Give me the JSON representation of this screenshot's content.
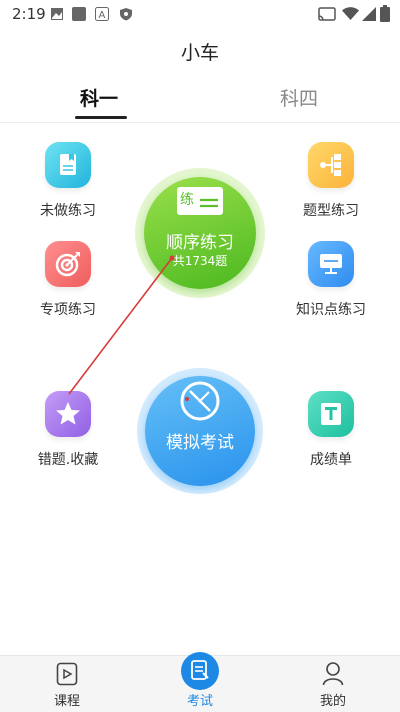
{
  "status": {
    "time": "2:19"
  },
  "header": {
    "title": "小车"
  },
  "tabs": [
    {
      "label": "科一"
    },
    {
      "label": "科四"
    }
  ],
  "features": {
    "undone": {
      "label": "未做练习"
    },
    "question_type": {
      "label": "题型练习"
    },
    "special": {
      "label": "专项练习"
    },
    "knowledge": {
      "label": "知识点练习"
    },
    "mistakes": {
      "label": "错题.收藏"
    },
    "score": {
      "label": "成绩单"
    }
  },
  "sequential": {
    "badge": "练",
    "label": "顺序练习",
    "count": "共1734题"
  },
  "mock_exam": {
    "label": "模拟考试"
  },
  "nav": [
    {
      "label": "课程"
    },
    {
      "label": "考试"
    },
    {
      "label": "我的"
    }
  ],
  "colors": {
    "accent": "#1e88e5",
    "green": "#66c92b",
    "blue": "#3aa2ef",
    "annotation": "#d83a3a"
  }
}
